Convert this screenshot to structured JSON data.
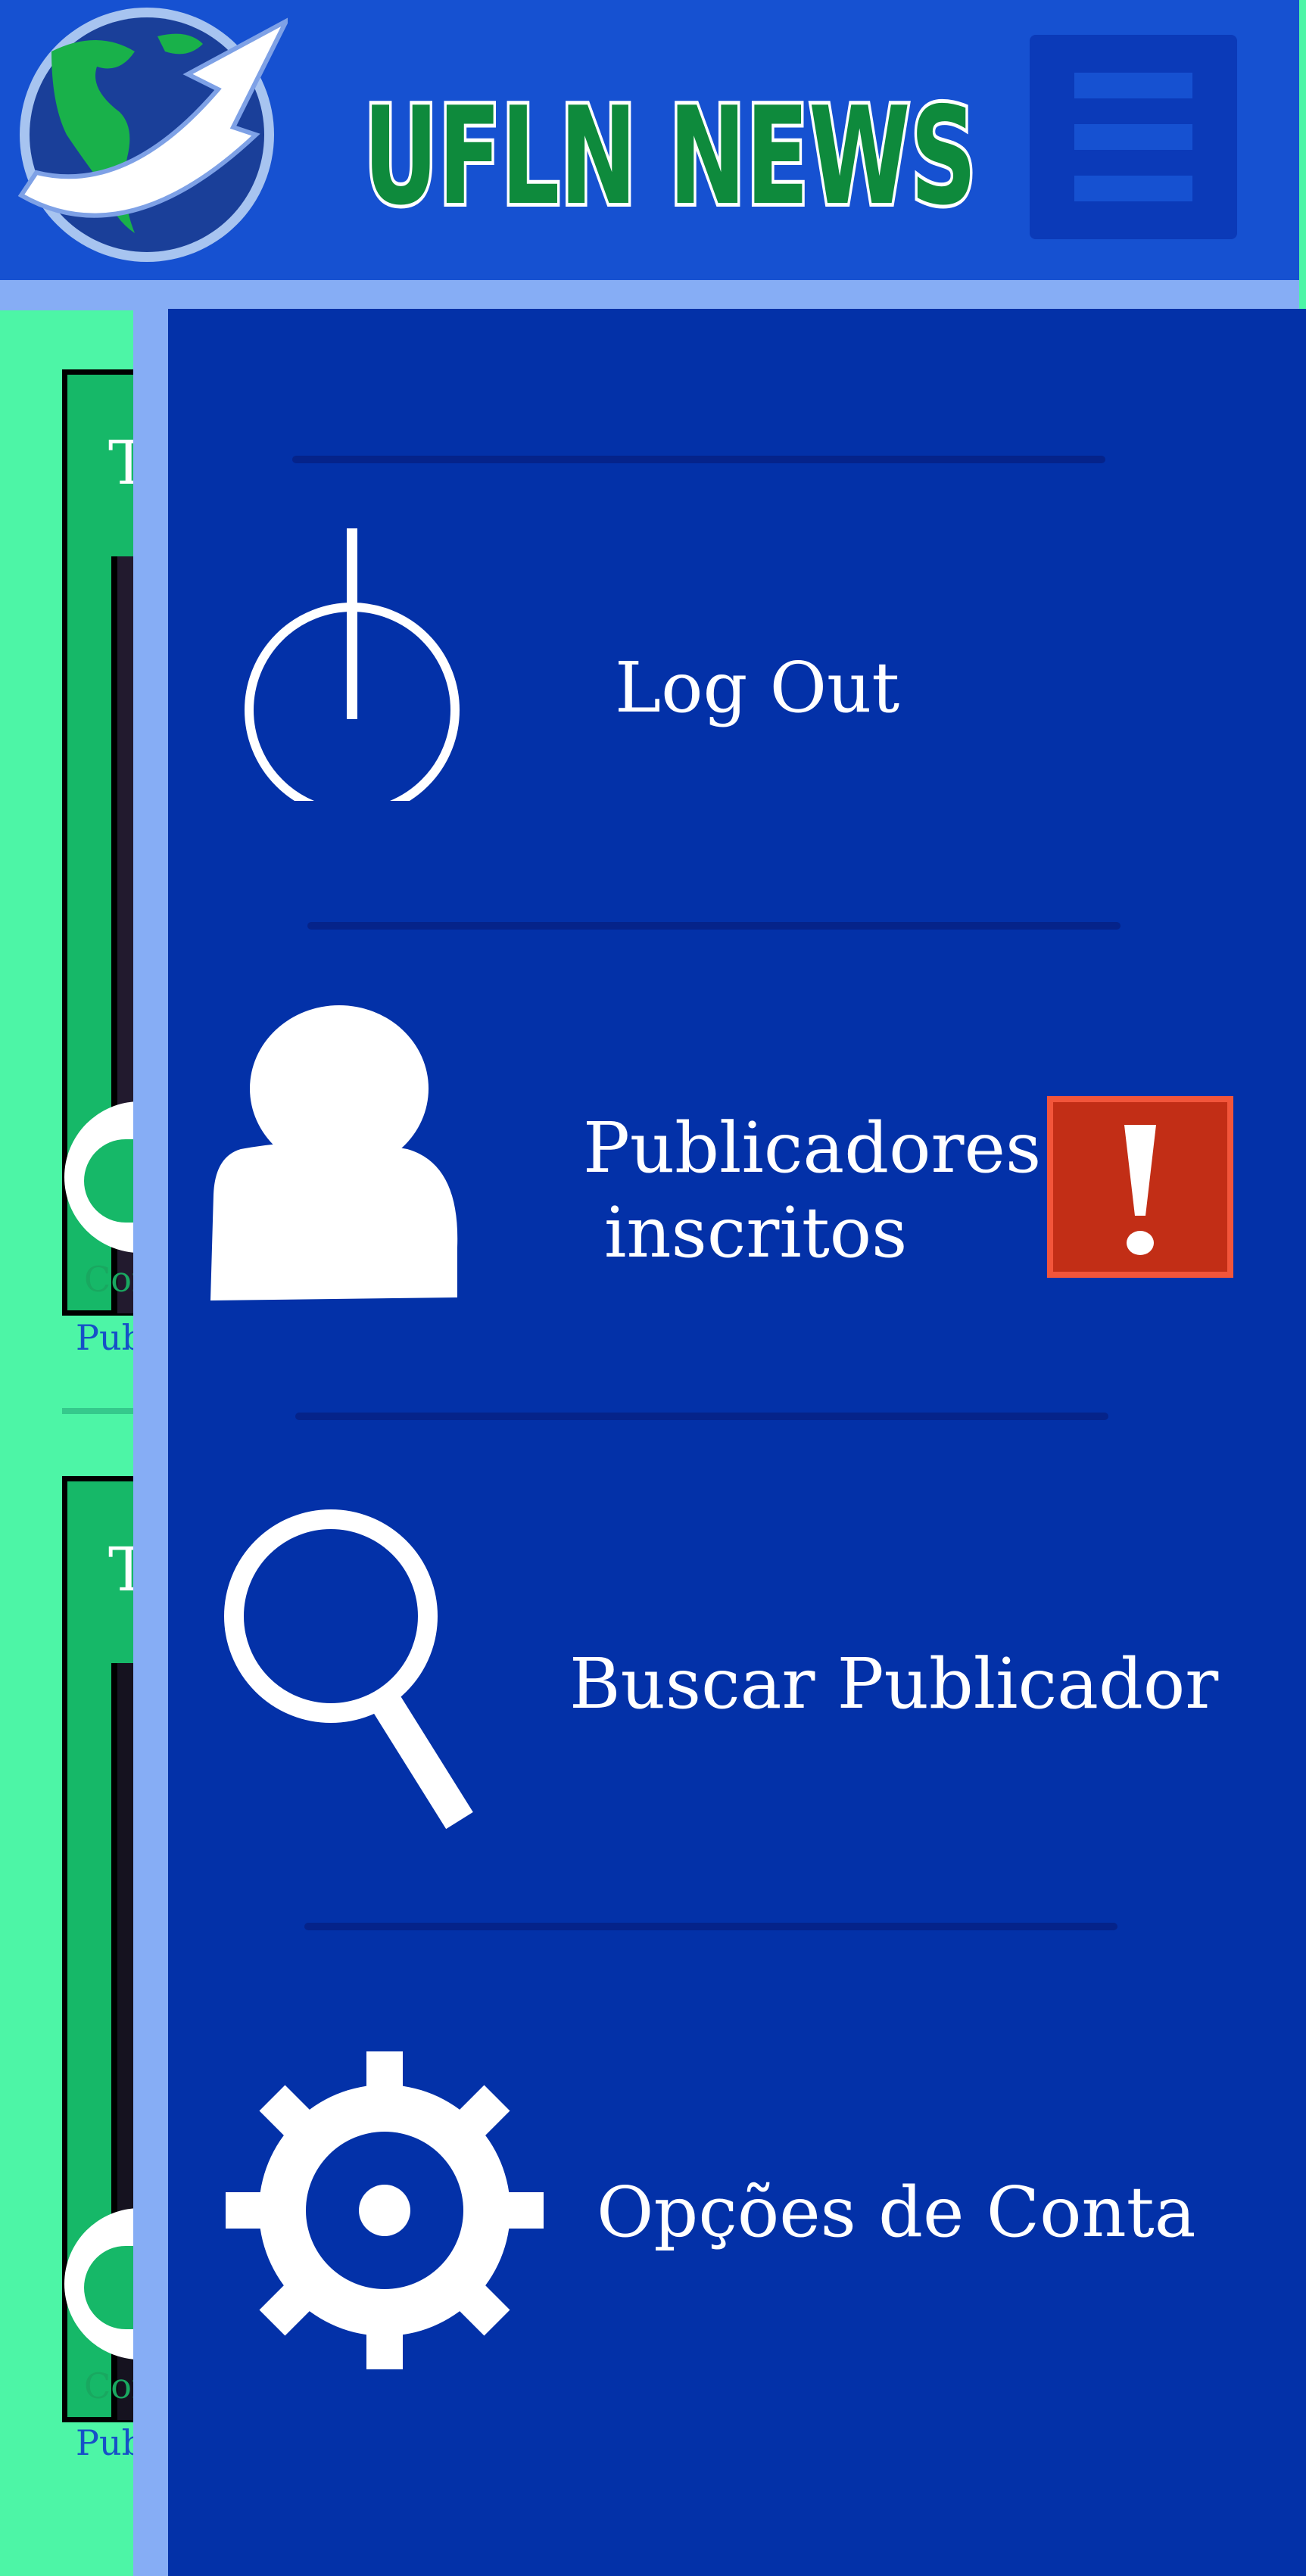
{
  "app": {
    "brand_text": "UFLN NEWS",
    "brand_color": "#0e8a3c",
    "header_color": "#1651d1"
  },
  "header": {
    "logo_icon": "globe-with-arrow-icon",
    "menu_icon": "hamburger-menu-icon"
  },
  "feed": {
    "cards": [
      {
        "title_initial": "T",
        "comment_label": "Con",
        "publisher_label": "Pub"
      },
      {
        "title_initial": "T",
        "comment_label": "Con",
        "publisher_label": "Pub"
      }
    ]
  },
  "drawer": {
    "items": [
      {
        "label": "Log Out",
        "icon": "power-icon"
      },
      {
        "label": "Publicadores inscritos",
        "label_line1": "Publicadores",
        "label_line2": "inscritos",
        "icon": "user-icon",
        "badge_icon": "exclamation-alert-icon",
        "badge_color": "#c22e16"
      },
      {
        "label": "Buscar Publicador",
        "icon": "search-icon"
      },
      {
        "label": "Opções de Conta",
        "icon": "gear-icon"
      }
    ]
  }
}
